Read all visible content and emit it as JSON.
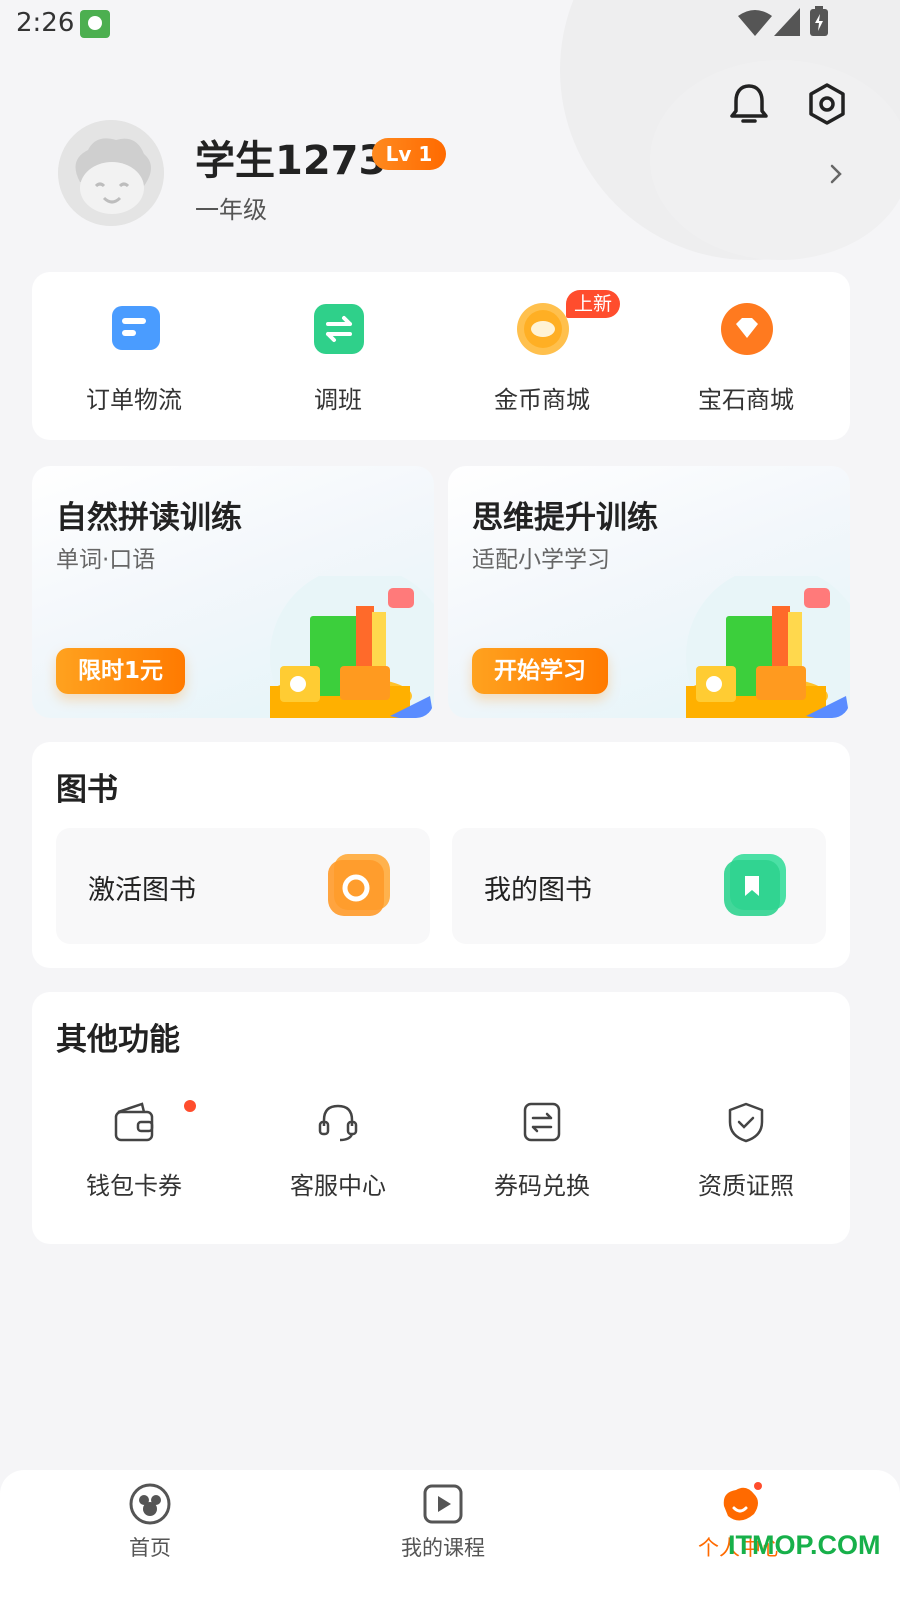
{
  "status_bar": {
    "time": "2:26"
  },
  "profile": {
    "name": "学生1273",
    "level": "Lv 1",
    "grade": "一年级"
  },
  "quick_actions": [
    {
      "label": "订单物流",
      "icon": "order-icon",
      "color": "#4a9cff"
    },
    {
      "label": "调班",
      "icon": "switch-class-icon",
      "color": "#2fd08a"
    },
    {
      "label": "金币商城",
      "icon": "coin-icon",
      "color": "#ffaf24",
      "badge": "上新"
    },
    {
      "label": "宝石商城",
      "icon": "gem-icon",
      "color": "#ff7a1f"
    }
  ],
  "training": [
    {
      "title": "自然拼读训练",
      "subtitle": "单词·口语",
      "button": "限时1元"
    },
    {
      "title": "思维提升训练",
      "subtitle": "适配小学学习",
      "button": "开始学习"
    }
  ],
  "books": {
    "title": "图书",
    "items": [
      {
        "label": "激活图书",
        "icon": "activate-book-icon",
        "color": "#ff9a2a"
      },
      {
        "label": "我的图书",
        "icon": "my-books-icon",
        "color": "#2fd38f"
      }
    ]
  },
  "other": {
    "title": "其他功能",
    "items": [
      {
        "label": "钱包卡券",
        "icon": "wallet-icon"
      },
      {
        "label": "客服中心",
        "icon": "headset-icon"
      },
      {
        "label": "券码兑换",
        "icon": "exchange-icon"
      },
      {
        "label": "资质证照",
        "icon": "shield-icon"
      }
    ]
  },
  "bottom_nav": [
    {
      "label": "首页",
      "icon": "home-icon",
      "active": false
    },
    {
      "label": "我的课程",
      "icon": "play-icon",
      "active": false
    },
    {
      "label": "个人中心",
      "icon": "profile-icon",
      "active": true
    }
  ],
  "accent_color": "#ff6a00",
  "watermark": "ITMOP.COM"
}
